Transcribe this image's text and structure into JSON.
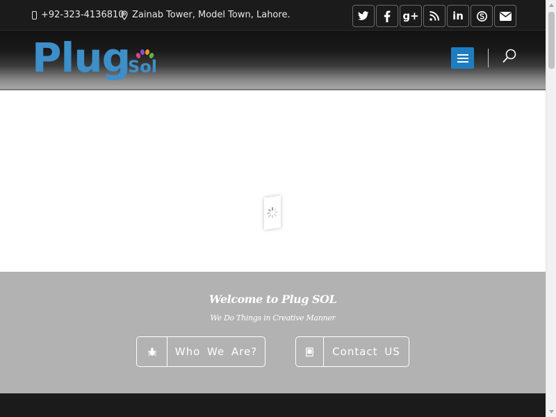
{
  "topbar": {
    "phone": "+92-323-4136810",
    "address": "Zainab Tower, Model Town, Lahore.",
    "phone_icon": "mobile-phone-icon",
    "address_icon": "map-pin-icon",
    "socials": [
      {
        "name": "twitter-icon"
      },
      {
        "name": "facebook-icon"
      },
      {
        "name": "google-plus-icon",
        "glyph": "g+"
      },
      {
        "name": "rss-icon"
      },
      {
        "name": "linkedin-icon",
        "glyph": "in"
      },
      {
        "name": "skype-icon"
      },
      {
        "name": "envelope-icon"
      }
    ]
  },
  "header": {
    "logo_main": "Plug",
    "logo_sub": "Sol",
    "menu_icon": "hamburger-menu-icon",
    "search_icon": "search-icon"
  },
  "hero": {
    "loader_icon": "spinner-icon"
  },
  "welcome": {
    "title": "Welcome to Plug SOL",
    "subtitle": "We Do Things in Creative Manner",
    "who_label": "Who We Are?",
    "who_icon": "bug-icon",
    "contact_label": "Contact US",
    "contact_icon": "tablet-icon"
  },
  "colors": {
    "accent": "#1f7dbf",
    "logo": "#3d8fc9",
    "topbar_bg": "#1b1b1b",
    "welcome_bg": "#b2b2b2"
  }
}
